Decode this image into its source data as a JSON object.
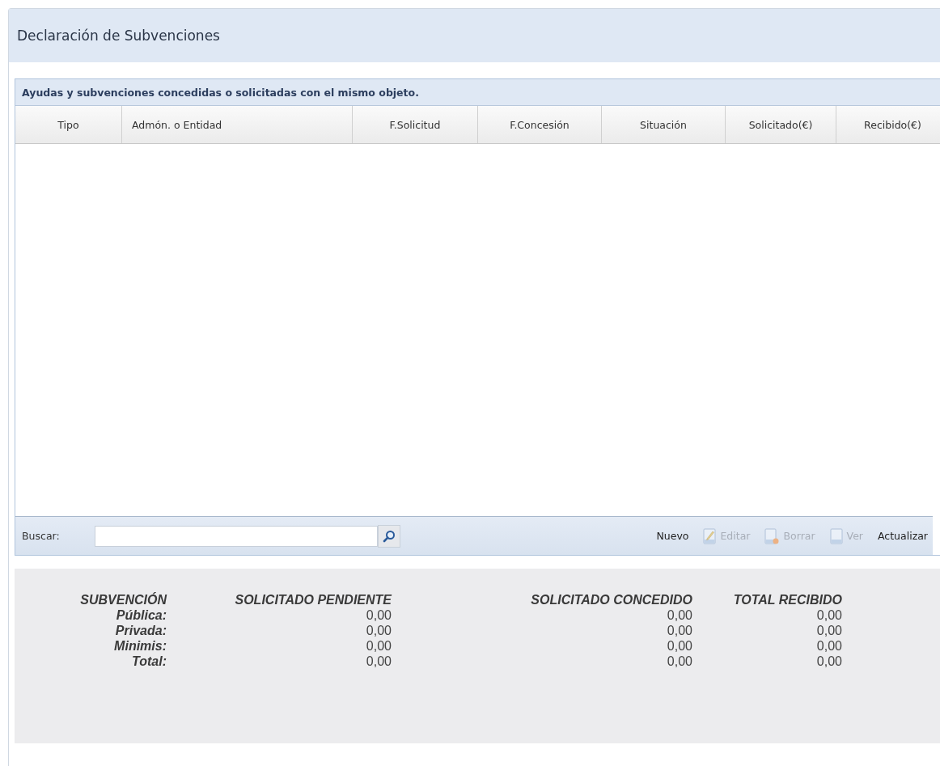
{
  "panel": {
    "title": "Declaración de Subvenciones"
  },
  "grid": {
    "title": "Ayudas y subvenciones concedidas o solicitadas con el mismo objeto.",
    "columns": [
      "Tipo",
      "Admón. o Entidad",
      "F.Solicitud",
      "F.Concesión",
      "Situación",
      "Solicitado(€)",
      "Recibido(€)"
    ]
  },
  "toolbar": {
    "search_label": "Buscar:",
    "buttons": [
      {
        "label": "Nuevo",
        "kind": "plain",
        "disabled": false
      },
      {
        "label": "Editar",
        "kind": "edit",
        "disabled": true
      },
      {
        "label": "Borrar",
        "kind": "delete",
        "disabled": true
      },
      {
        "label": "Ver",
        "kind": "view",
        "disabled": true
      },
      {
        "label": "Actualizar",
        "kind": "plain",
        "disabled": false
      }
    ]
  },
  "summary": {
    "headers": [
      "SUBVENCIÓN",
      "SOLICITADO PENDIENTE",
      "SOLICITADO CONCEDIDO",
      "TOTAL RECIBIDO"
    ],
    "rows": [
      {
        "label": "Pública:",
        "values": [
          "0,00",
          "0,00",
          "0,00"
        ]
      },
      {
        "label": "Privada:",
        "values": [
          "0,00",
          "0,00",
          "0,00"
        ]
      },
      {
        "label": "Minimis:",
        "values": [
          "0,00",
          "0,00",
          "0,00"
        ]
      },
      {
        "label": "Total:",
        "values": [
          "0,00",
          "0,00",
          "0,00"
        ]
      }
    ]
  }
}
